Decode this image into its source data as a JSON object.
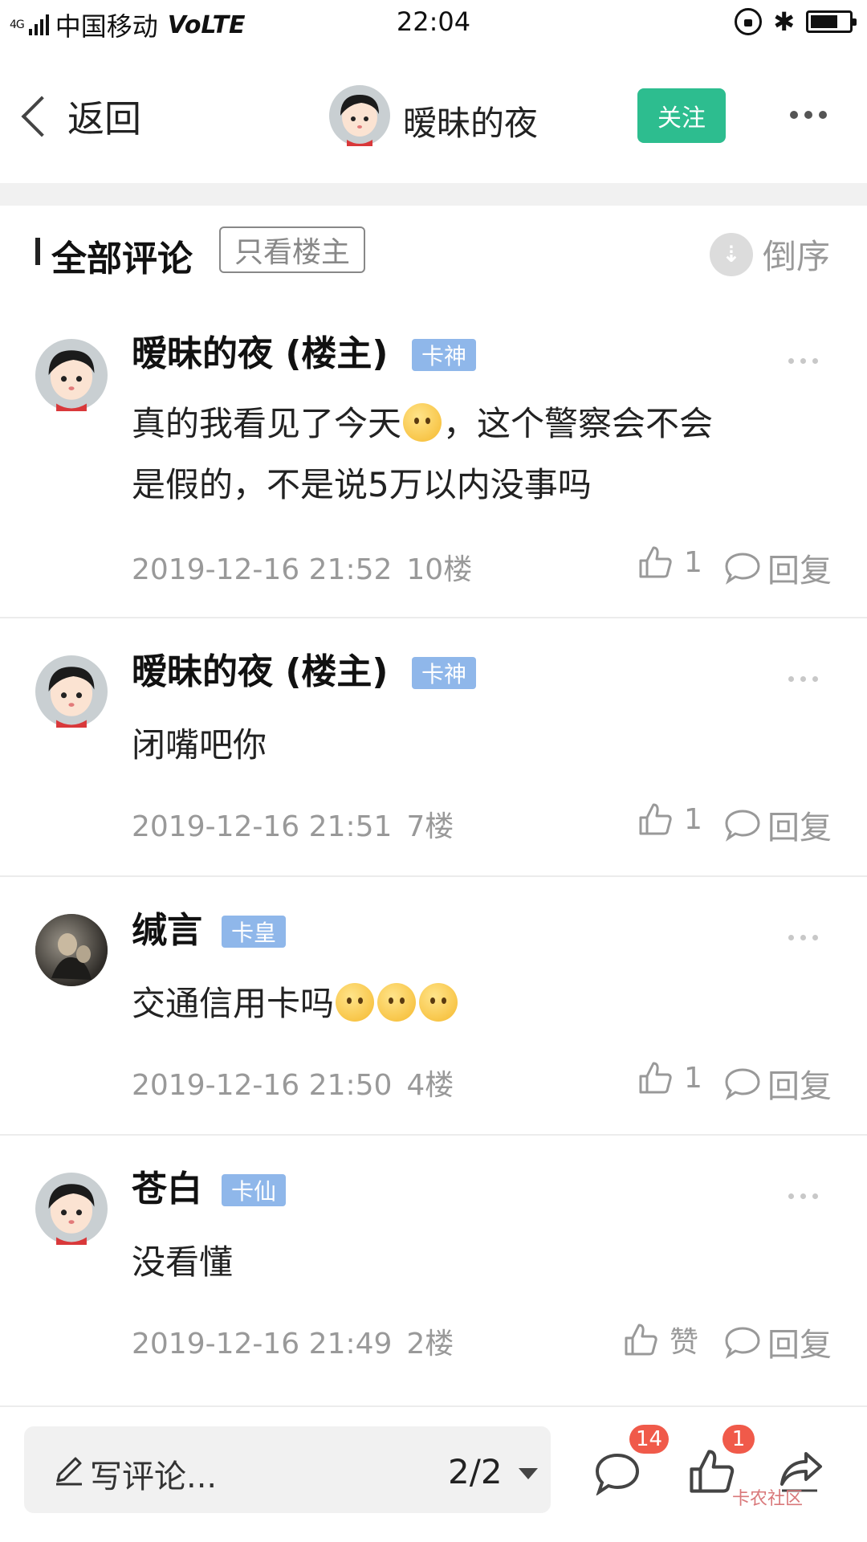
{
  "status_bar": {
    "network": "4G",
    "carrier": "中国移动",
    "volte": "VoLTE",
    "time": "22:04",
    "icons": [
      "signal-icon",
      "lock-rotation-icon",
      "bluetooth-icon",
      "battery-icon"
    ]
  },
  "nav": {
    "back_label": "返回",
    "title": "暧昧的夜",
    "follow_label": "关注"
  },
  "section": {
    "title": "全部评论",
    "only_op_label": "只看楼主",
    "sort_label": "倒序"
  },
  "comments": [
    {
      "author": "暧昧的夜 (楼主)",
      "badge": "卡神",
      "text_line1": "真的我看见了今天",
      "text_line1_after": "，这个警察会不会",
      "text_line2": "是假的，不是说5万以内没事吗",
      "emoji": [
        "astonished-emoji"
      ],
      "time": "2019-12-16 21:52",
      "floor": "10楼",
      "likes": "1",
      "reply_label": "回复"
    },
    {
      "author": "暧昧的夜 (楼主)",
      "badge": "卡神",
      "text": "闭嘴吧你",
      "time": "2019-12-16 21:51",
      "floor": "7楼",
      "likes": "1",
      "reply_label": "回复"
    },
    {
      "author": "缄言",
      "badge": "卡皇",
      "text": "交通信用卡吗",
      "emoji": [
        "frown-emoji",
        "frown-emoji",
        "frown-emoji"
      ],
      "time": "2019-12-16 21:50",
      "floor": "4楼",
      "likes": "1",
      "reply_label": "回复"
    },
    {
      "author": "苍白",
      "badge": "卡仙",
      "text": "没看懂",
      "time": "2019-12-16 21:49",
      "floor": "2楼",
      "likes": "赞",
      "reply_label": "回复"
    }
  ],
  "bottom_bar": {
    "write_label": "写评论...",
    "page_indicator": "2/2",
    "comment_count": "14",
    "like_count": "1",
    "watermark": "卡农社区"
  },
  "colors": {
    "accent_green": "#2dbd8f",
    "badge_blue": "#8fb7ea",
    "badge_red": "#f05a4a",
    "muted_gray": "#999999"
  }
}
